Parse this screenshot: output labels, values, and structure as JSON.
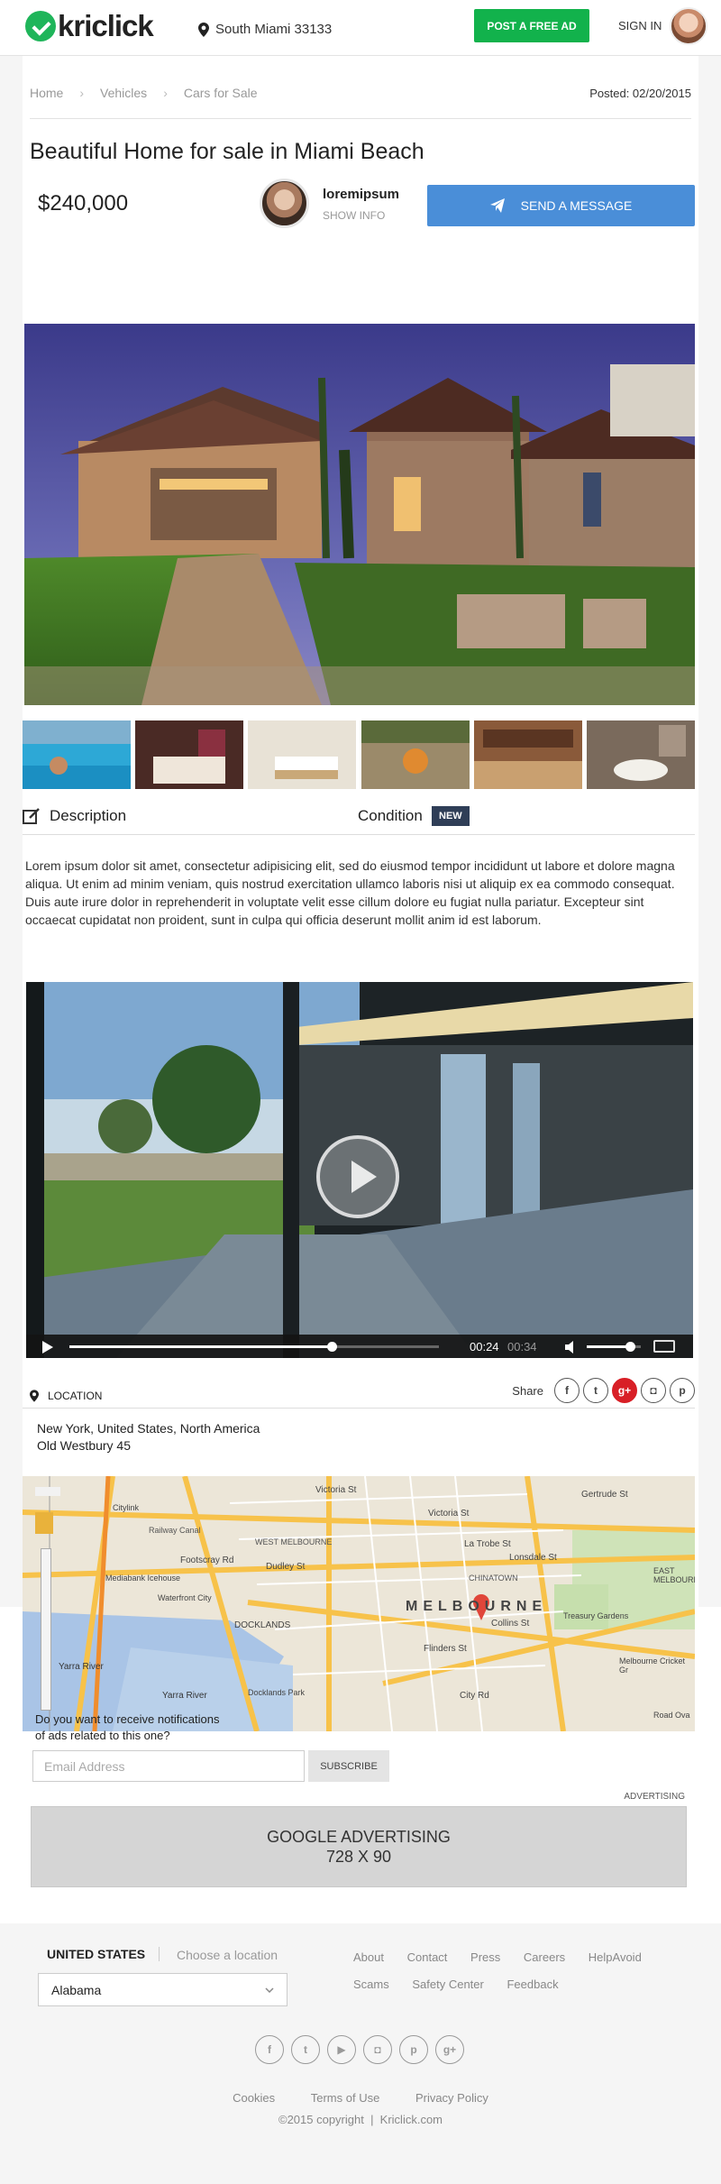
{
  "header": {
    "logo_text": "kriclick",
    "location": "South Miami 33133",
    "post_button": "POST A FREE AD",
    "sign_in": "SIGN IN"
  },
  "breadcrumb": [
    "Home",
    "Vehicles",
    "Cars for Sale"
  ],
  "breadcrumb_separator": "›",
  "posted": "Posted: 02/20/2015",
  "listing": {
    "title": "Beautiful Home for sale in Miami Beach",
    "price": "$240,000",
    "seller_name": "loremipsum",
    "show_info": "SHOW INFO",
    "send_message": "SEND A MESSAGE"
  },
  "description": {
    "heading": "Description",
    "condition_label": "Condition",
    "condition_value": "NEW",
    "text": "Lorem ipsum dolor sit amet, consectetur adipisicing elit, sed do eiusmod tempor incididunt ut labore et dolore magna aliqua. Ut enim ad minim veniam, quis nostrud exercitation ullamco laboris nisi ut aliquip ex ea commodo consequat. Duis aute irure dolor in reprehenderit in voluptate velit esse cillum dolore eu fugiat nulla pariatur. Excepteur sint occaecat cupidatat non proident, sunt in culpa qui officia deserunt mollit anim id est laborum."
  },
  "video": {
    "current_time": "00:24",
    "total_time": "00:34",
    "progress_fraction": 0.71,
    "volume_fraction": 0.8
  },
  "location": {
    "label": "LOCATION",
    "share_label": "Share",
    "share_icons": [
      "facebook-icon",
      "twitter-icon",
      "google-plus-icon",
      "instagram-icon",
      "pinterest-icon"
    ],
    "address_line1": "New York, United States, North America",
    "address_line2": "Old Westbury 45"
  },
  "map": {
    "city_label": "MELBOURNE",
    "labels": [
      "Victoria St",
      "Gertrude St",
      "Railway Canal",
      "WEST MELBOURNE",
      "Victoria St",
      "La Trobe St",
      "Lonsdale St",
      "CHINATOWN",
      "Footscray Rd",
      "Dudley St",
      "Mediabank Icehouse",
      "Waterfront City",
      "DOCKLANDS",
      "Collins St",
      "Treasury Gardens",
      "Flinders St",
      "Yarra River",
      "Yarra River",
      "Docklands Park",
      "City Rd",
      "Melbourne Cricket Gr",
      "Road Ova",
      "EAST MELBOURNE",
      "Citylink"
    ]
  },
  "newsletter": {
    "prompt_line1": "Do you want to receive notifications",
    "prompt_line2": "of ads related to this one?",
    "email_placeholder": "Email Address",
    "subscribe": "SUBSCRIBE"
  },
  "advertising": {
    "label": "ADVERTISING",
    "line1": "GOOGLE ADVERTISING",
    "line2": "728 X 90"
  },
  "footer": {
    "country": "UNITED STATES",
    "choose_location": "Choose a location",
    "state_selected": "Alabama",
    "links": [
      "About",
      "Contact",
      "Press",
      "Careers",
      "HelpAvoid",
      "Scams",
      "Safety Center",
      "Feedback"
    ],
    "social_icons": [
      "facebook-icon",
      "twitter-icon",
      "youtube-icon",
      "instagram-icon",
      "pinterest-icon",
      "google-plus-icon"
    ],
    "legal_links": [
      "Cookies",
      "Terms of Use",
      "Privacy Policy"
    ],
    "copyright": "©2015 copyright  |  Kriclick.com"
  }
}
